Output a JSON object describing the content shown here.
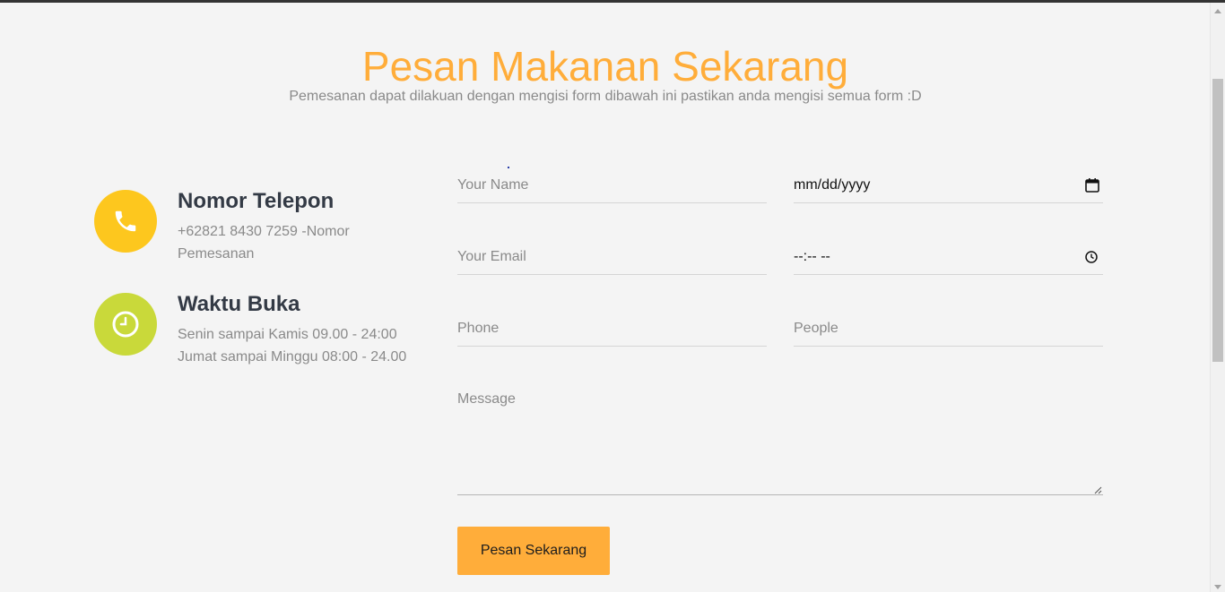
{
  "header": {
    "title": "Pesan Makanan Sekarang",
    "subtitle": "Pemesanan dapat dilakuan dengan mengisi form dibawah ini pastikan anda mengisi semua form :D"
  },
  "contact": {
    "phone": {
      "icon": "phone-icon",
      "title": "Nomor Telepon",
      "text": "+62821 8430 7259 -Nomor Pemesanan",
      "color": "#fdc71e"
    },
    "hours": {
      "icon": "clock-icon",
      "title": "Waktu Buka",
      "line1": "Senin sampai Kamis 09.00 - 24:00",
      "line2": "Jumat sampai Minggu 08:00 - 24.00",
      "color": "#c9d93a"
    }
  },
  "form": {
    "name_placeholder": "Your Name",
    "date_value": "mm/dd/yyyy",
    "email_placeholder": "Your Email",
    "time_value": "--:-- --",
    "phone_placeholder": "Phone",
    "people_placeholder": "People",
    "message_placeholder": "Message",
    "submit_label": "Pesan Sekarang"
  },
  "colors": {
    "accent": "#ffad3a",
    "background": "#f4f4f4"
  }
}
